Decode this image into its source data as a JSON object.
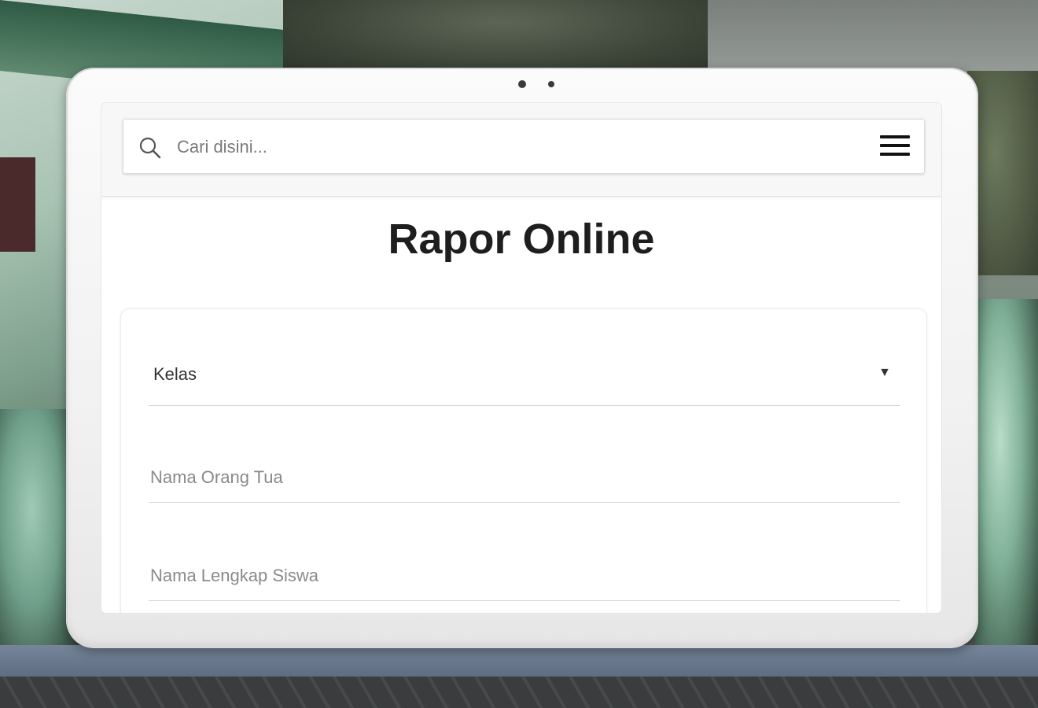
{
  "search": {
    "placeholder": "Cari disini...",
    "value": ""
  },
  "icons": {
    "search": "search-icon",
    "menu": "hamburger-menu-icon",
    "caret": "caret-down-icon"
  },
  "page": {
    "title": "Rapor Online"
  },
  "form": {
    "kelas": {
      "selected": "Kelas",
      "caret": "▼"
    },
    "nama_orang_tua": {
      "placeholder": "Nama Orang Tua",
      "value": ""
    },
    "nama_lengkap_siswa": {
      "placeholder": "Nama Lengkap Siswa",
      "value": ""
    }
  },
  "colors": {
    "title": "#1e1e1e",
    "screen_bg": "#ffffff",
    "topbar_bg": "#f7f7f7",
    "divider": "#d7d7d7"
  }
}
